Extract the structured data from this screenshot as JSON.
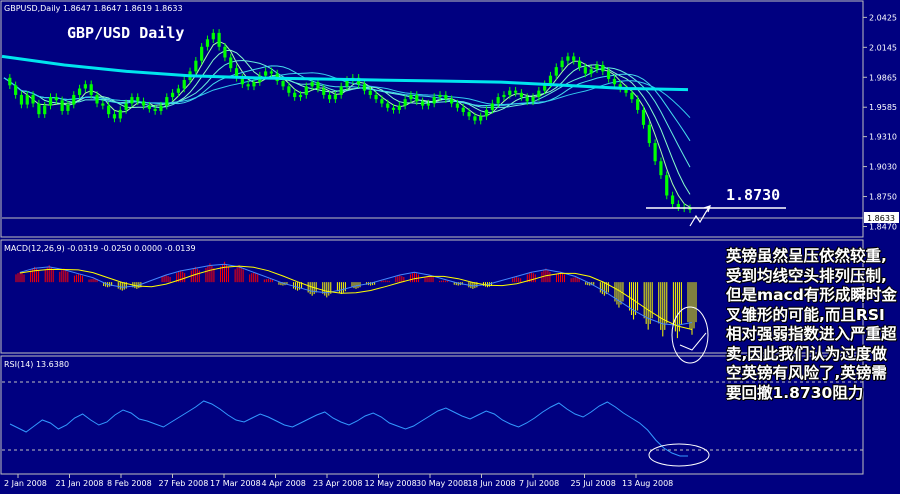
{
  "window": {
    "price_header": "GBPUSD,Daily  1.8647 1.8647 1.8619 1.8633",
    "macd_header": "MACD(12,26,9) -0.0319 -0.0250 0.0000 -0.0139",
    "rsi_header": "RSI(14) 13.6380",
    "chart_title": "GBP/USD Daily",
    "current_price_label": "1.8633"
  },
  "annotation": {
    "level_label": "1.8730",
    "note": "英镑虽然呈压依然较重,受到均线空头排列压制,但是macd有形成瞬时金叉雏形的可能,而且RSI相对强弱指数进入严重超卖,因此我们认为过度做空英镑有风险了,英镑需要回撤1.8730阻力"
  },
  "colors": {
    "background": "#000080",
    "bull_candle": "#00ff00",
    "ma_slow": "#00e5ee",
    "macd_positive": "#ff0000",
    "macd_negative": "#ffff00",
    "macd_signal": "#ffff00",
    "macd_line": "#4488ff",
    "rsi_line": "#3399ff",
    "annotation": "#ffffff"
  },
  "chart_data": [
    {
      "type": "line",
      "panel": "price",
      "price_axis_ticks": [
        "2.0425",
        "2.0145",
        "1.9865",
        "1.9585",
        "1.9310",
        "1.9030",
        "1.8750",
        "1.8470"
      ],
      "ylim": [
        1.84,
        2.055
      ],
      "date_ticks": [
        "2 Jan 2008",
        "21 Jan 2008",
        "8 Feb 2008",
        "27 Feb 2008",
        "17 Mar 2008",
        "4 Apr 2008",
        "23 Apr 2008",
        "12 May 2008",
        "30 May 2008",
        "18 Jun 2008",
        "7 Jul 2008",
        "25 Jul 2008",
        "13 Aug 2008"
      ],
      "close_series": [
        1.986,
        1.979,
        1.97,
        1.961,
        1.97,
        1.962,
        1.952,
        1.96,
        1.968,
        1.965,
        1.955,
        1.961,
        1.97,
        1.976,
        1.98,
        1.97,
        1.962,
        1.96,
        1.952,
        1.948,
        1.956,
        1.962,
        1.968,
        1.964,
        1.96,
        1.957,
        1.955,
        1.96,
        1.968,
        1.972,
        1.976,
        1.984,
        1.992,
        2.002,
        2.015,
        2.022,
        2.028,
        2.015,
        2.005,
        1.995,
        1.986,
        1.98,
        1.978,
        1.982,
        1.988,
        1.992,
        1.99,
        1.983,
        1.978,
        1.972,
        1.968,
        1.97,
        1.978,
        1.982,
        1.976,
        1.97,
        1.966,
        1.97,
        1.978,
        1.984,
        1.986,
        1.98,
        1.974,
        1.97,
        1.966,
        1.962,
        1.958,
        1.956,
        1.96,
        1.966,
        1.97,
        1.964,
        1.96,
        1.962,
        1.968,
        1.97,
        1.966,
        1.962,
        1.958,
        1.954,
        1.95,
        1.946,
        1.95,
        1.956,
        1.962,
        1.968,
        1.97,
        1.974,
        1.972,
        1.968,
        1.964,
        1.968,
        1.974,
        1.98,
        1.988,
        1.996,
        2.002,
        2.006,
        2.002,
        1.996,
        1.99,
        1.994,
        1.998,
        1.992,
        1.985,
        1.98,
        1.976,
        1.972,
        1.966,
        1.956,
        1.942,
        1.925,
        1.908,
        1.895,
        1.876,
        1.868,
        1.865,
        1.864,
        1.8633
      ],
      "ma_slow": [
        2.006,
        1.998,
        1.992,
        1.988,
        1.986,
        1.985,
        1.984,
        1.983,
        1.982,
        1.979,
        1.976
      ],
      "ma_slow_end": 1.975
    },
    {
      "type": "line",
      "panel": "macd",
      "histogram": [
        0.006,
        0.009,
        0.01,
        0.008,
        0.005,
        0.002,
        -0.003,
        -0.005,
        -0.004,
        0.0,
        0.004,
        0.007,
        0.009,
        0.011,
        0.012,
        0.01,
        0.006,
        0.002,
        -0.002,
        -0.005,
        -0.008,
        -0.009,
        -0.007,
        -0.004,
        -0.002,
        0.001,
        0.004,
        0.006,
        0.004,
        0.001,
        -0.002,
        -0.004,
        -0.003,
        0.0,
        0.003,
        0.006,
        0.008,
        0.006,
        0.003,
        -0.002,
        -0.008,
        -0.015,
        -0.022,
        -0.028,
        -0.032,
        -0.033,
        -0.031
      ],
      "ylim": [
        -0.04,
        0.016
      ]
    },
    {
      "type": "line",
      "panel": "rsi",
      "values": [
        46,
        42,
        38,
        44,
        50,
        47,
        41,
        45,
        52,
        56,
        50,
        45,
        48,
        55,
        60,
        57,
        51,
        49,
        46,
        43,
        48,
        53,
        58,
        63,
        69,
        66,
        61,
        55,
        50,
        48,
        52,
        56,
        53,
        49,
        45,
        43,
        47,
        51,
        55,
        58,
        52,
        48,
        45,
        49,
        54,
        57,
        53,
        47,
        44,
        41,
        44,
        49,
        54,
        59,
        62,
        58,
        54,
        51,
        55,
        59,
        56,
        50,
        46,
        43,
        47,
        52,
        58,
        63,
        67,
        61,
        56,
        53,
        58,
        64,
        68,
        63,
        57,
        52,
        47,
        40,
        30,
        22,
        17,
        14,
        14
      ],
      "levels": [
        70,
        30
      ],
      "ylim": [
        0,
        100
      ]
    }
  ]
}
